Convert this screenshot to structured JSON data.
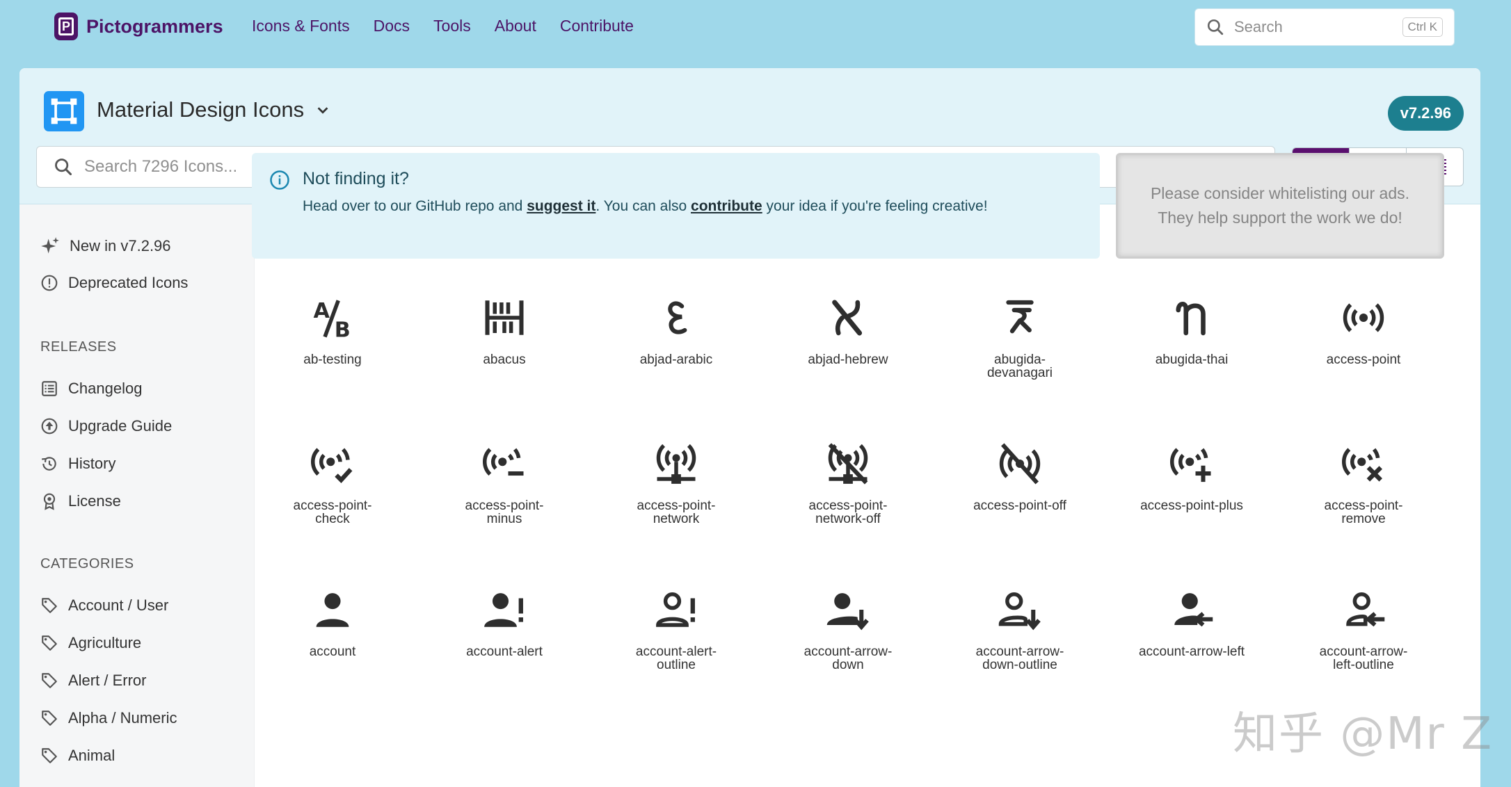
{
  "brand": {
    "name": "Pictogrammers"
  },
  "nav": [
    "Icons & Fonts",
    "Docs",
    "Tools",
    "About",
    "Contribute"
  ],
  "top_search": {
    "placeholder": "Search",
    "shortcut": "Ctrl K"
  },
  "library": {
    "title": "Material Design Icons",
    "version": "v7.2.96"
  },
  "icon_search": {
    "placeholder": "Search 7296 Icons..."
  },
  "sidebar": {
    "top_items": [
      "New in v7.2.96",
      "Deprecated Icons"
    ],
    "releases_heading": "RELEASES",
    "releases": [
      "Changelog",
      "Upgrade Guide",
      "History",
      "License"
    ],
    "categories_heading": "CATEGORIES",
    "categories": [
      "Account / User",
      "Agriculture",
      "Alert / Error",
      "Alpha / Numeric",
      "Animal"
    ]
  },
  "notice": {
    "title": "Not finding it?",
    "text1": "Head over to our GitHub repo and ",
    "link1": "suggest it",
    "text2": ". You can also ",
    "link2": "contribute",
    "text3": " your idea if you're feeling creative!"
  },
  "ad": {
    "line1": "Please consider whitelisting our ads.",
    "line2": "They help support the work we do!"
  },
  "icons": [
    [
      "ab-testing",
      "abacus",
      "abjad-arabic",
      "abjad-hebrew",
      "abugida-devanagari",
      "abugida-thai",
      "access-point"
    ],
    [
      "access-point-check",
      "access-point-minus",
      "access-point-network",
      "access-point-network-off",
      "access-point-off",
      "access-point-plus",
      "access-point-remove"
    ],
    [
      "account",
      "account-alert",
      "account-alert-outline",
      "account-arrow-down",
      "account-arrow-down-outline",
      "account-arrow-left",
      "account-arrow-left-outline"
    ]
  ],
  "icon_labels_wrapped": {
    "abugida-devanagari": [
      "abugida-",
      "devanagari"
    ],
    "access-point-check": [
      "access-point-",
      "check"
    ],
    "access-point-minus": [
      "access-point-",
      "minus"
    ],
    "access-point-network": [
      "access-point-",
      "network"
    ],
    "access-point-network-off": [
      "access-point-",
      "network-off"
    ],
    "access-point-remove": [
      "access-point-",
      "remove"
    ],
    "account-alert-outline": [
      "account-alert-",
      "outline"
    ],
    "account-arrow-down": [
      "account-arrow-",
      "down"
    ],
    "account-arrow-down-outline": [
      "account-arrow-",
      "down-outline"
    ],
    "account-arrow-left-outline": [
      "account-arrow-",
      "left-outline"
    ]
  },
  "watermark": "知乎 @Mr Z"
}
